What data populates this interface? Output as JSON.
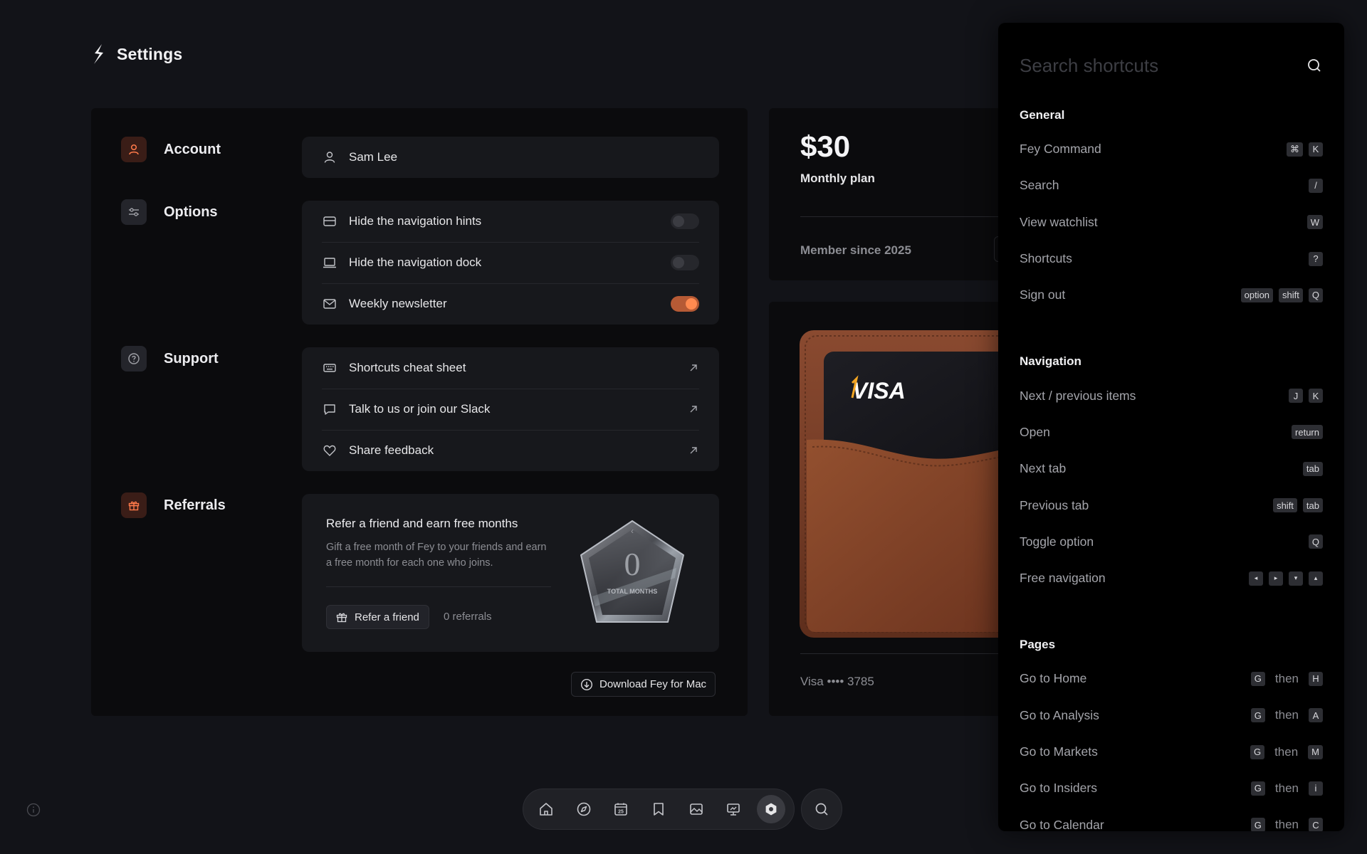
{
  "header": {
    "title": "Settings"
  },
  "sections": {
    "account": "Account",
    "options": "Options",
    "support": "Support",
    "referrals": "Referrals"
  },
  "account": {
    "name": "Sam Lee"
  },
  "options": [
    {
      "label": "Hide the navigation hints",
      "on": false
    },
    {
      "label": "Hide the navigation dock",
      "on": false
    },
    {
      "label": "Weekly newsletter",
      "on": true
    }
  ],
  "support": [
    {
      "label": "Shortcuts cheat sheet"
    },
    {
      "label": "Talk to us or join our Slack"
    },
    {
      "label": "Share feedback"
    }
  ],
  "referral": {
    "title": "Refer a friend and earn free months",
    "description": "Gift a free month of Fey to your friends and earn a free month for each one who joins.",
    "button": "Refer a friend",
    "count": "0 referrals",
    "badge_value": "0",
    "badge_label": "TOTAL MONTHS"
  },
  "download": {
    "label": "Download Fey for Mac"
  },
  "plan": {
    "price": "$30",
    "name": "Monthly plan",
    "member_since": "Member since 2025"
  },
  "payment": {
    "brand": "VISA",
    "card_label": "Visa •••• 3785"
  },
  "shortcuts": {
    "placeholder": "Search shortcuts",
    "then_label": "then",
    "groups": [
      {
        "title": "General",
        "items": [
          {
            "label": "Fey Command",
            "keys": [
              "⌘",
              "K"
            ]
          },
          {
            "label": "Search",
            "keys": [
              "/"
            ]
          },
          {
            "label": "View watchlist",
            "keys": [
              "W"
            ]
          },
          {
            "label": "Shortcuts",
            "keys": [
              "?"
            ]
          },
          {
            "label": "Sign out",
            "keys": [
              "option",
              "shift",
              "Q"
            ]
          }
        ]
      },
      {
        "title": "Navigation",
        "items": [
          {
            "label": "Next / previous items",
            "keys": [
              "J",
              "K"
            ]
          },
          {
            "label": "Open",
            "keys": [
              "return"
            ]
          },
          {
            "label": "Next tab",
            "keys": [
              "tab"
            ]
          },
          {
            "label": "Previous tab",
            "keys": [
              "shift",
              "tab"
            ]
          },
          {
            "label": "Toggle option",
            "keys": [
              "Q"
            ]
          },
          {
            "label": "Free navigation",
            "keys": [
              "◂",
              "▸",
              "▾",
              "▴"
            ]
          }
        ]
      },
      {
        "title": "Pages",
        "items": [
          {
            "label": "Go to Home",
            "keys": [
              "G",
              "H"
            ],
            "sequence": true
          },
          {
            "label": "Go to Analysis",
            "keys": [
              "G",
              "A"
            ],
            "sequence": true
          },
          {
            "label": "Go to Markets",
            "keys": [
              "G",
              "M"
            ],
            "sequence": true
          },
          {
            "label": "Go to Insiders",
            "keys": [
              "G",
              "i"
            ],
            "sequence": true
          },
          {
            "label": "Go to Calendar",
            "keys": [
              "G",
              "C"
            ],
            "sequence": true
          }
        ]
      }
    ]
  },
  "dock": {
    "items": [
      "home-icon",
      "compass-icon",
      "calendar-icon",
      "bookmark-icon",
      "image-icon",
      "presentation-icon",
      "settings-icon"
    ],
    "calendar_day": "25",
    "active": "settings-icon"
  },
  "colors": {
    "accent": "#ff8a50",
    "background": "#121318",
    "panel": "#0b0b0d"
  }
}
